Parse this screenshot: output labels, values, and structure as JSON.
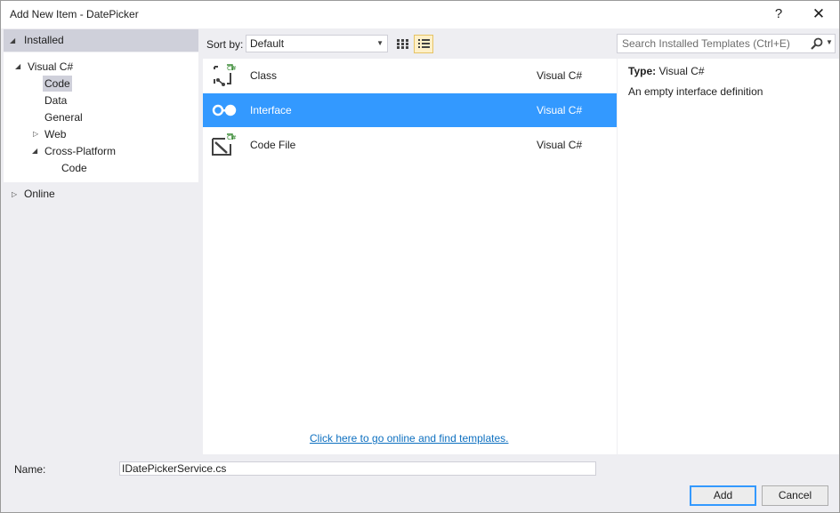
{
  "window": {
    "title": "Add New Item - DatePicker",
    "help_label": "?",
    "close_label": "✕"
  },
  "tree": {
    "installed_label": "Installed",
    "online_label": "Online",
    "items": [
      {
        "label": "Visual C#"
      },
      {
        "label": "Code"
      },
      {
        "label": "Data"
      },
      {
        "label": "General"
      },
      {
        "label": "Web"
      },
      {
        "label": "Cross-Platform"
      },
      {
        "label": "Code"
      }
    ],
    "selected_item": "Code"
  },
  "toolbar": {
    "sort_label": "Sort by:",
    "sort_value": "Default",
    "view_small_icons": "small-icons-view-icon",
    "view_list": "list-view-icon"
  },
  "templates": [
    {
      "name": "Class",
      "language": "Visual C#",
      "icon": "class-template-icon"
    },
    {
      "name": "Interface",
      "language": "Visual C#",
      "icon": "interface-template-icon"
    },
    {
      "name": "Code File",
      "language": "Visual C#",
      "icon": "code-file-template-icon"
    }
  ],
  "selected_template": "Interface",
  "online_link": "Click here to go online and find templates.",
  "search": {
    "placeholder": "Search Installed Templates (Ctrl+E)"
  },
  "details": {
    "type_label": "Type:",
    "type_value": "Visual C#",
    "description": "An empty interface definition"
  },
  "name_field": {
    "label": "Name:",
    "value": "IDatePickerService.cs"
  },
  "buttons": {
    "add": "Add",
    "cancel": "Cancel"
  },
  "colors": {
    "selection": "#3399ff",
    "link": "#0e70c0",
    "tree_selection": "#cfd0da",
    "csharp_green": "#388a34"
  }
}
